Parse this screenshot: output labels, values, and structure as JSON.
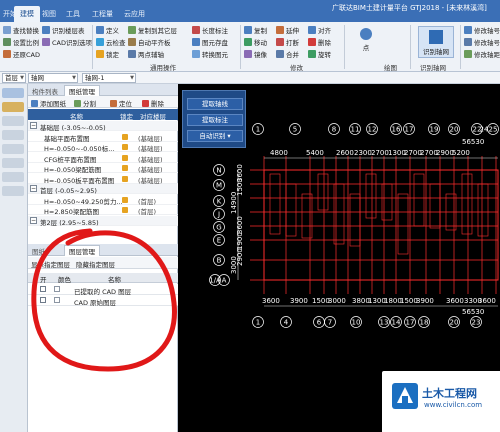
{
  "app": {
    "title": "广联达BIM土建计量平台 GTJ2018 - [未来林溪湾]"
  },
  "menu_tabs": [
    {
      "label": "开始",
      "active": false
    },
    {
      "label": "建模",
      "active": true
    },
    {
      "label": "视图",
      "active": false
    },
    {
      "label": "工具",
      "active": false
    },
    {
      "label": "工程量",
      "active": false
    },
    {
      "label": "云应用",
      "active": false
    }
  ],
  "ribbon": {
    "cad_group": {
      "items": [
        "查找替换",
        "设置比例",
        "还原CAD"
      ],
      "items2": [
        "识别楼层表",
        "CAD识别选项"
      ]
    },
    "general_group": {
      "label": "通用操作",
      "items": [
        "定义",
        "云检查",
        "锁定",
        "复制到其它层",
        "自动平齐板",
        "两点辅轴"
      ],
      "items2": [
        "长度标注",
        "图元存盘",
        "转换图元"
      ]
    },
    "edit_group": {
      "label": "修改",
      "items": [
        "复制",
        "移动",
        "镜像",
        "延伸",
        "打断",
        "合并",
        "对齐",
        "删除",
        "旋转"
      ]
    },
    "draw_group": {
      "label": "绘图",
      "items": [
        "点"
      ]
    },
    "identify_group": {
      "label": "识别轴网",
      "items": [
        "识别轴网"
      ]
    },
    "right_group": {
      "items": [
        "修改轴号位置",
        "修改轴号",
        "修改轴距"
      ]
    }
  },
  "propbar": {
    "floor_combo": "首层",
    "category_combo": "轴网",
    "element_combo": "轴网-1"
  },
  "panel": {
    "tabs": [
      {
        "label": "构件列表",
        "active": false
      },
      {
        "label": "图纸管理",
        "active": true
      }
    ],
    "toolbar": [
      "添加图纸",
      "分割",
      "定位",
      "删除"
    ],
    "columns": [
      "名称",
      "锁定",
      "对应楼层"
    ],
    "rows": [
      {
        "kind": "group",
        "name": "基础层 (-3.05~-0.05)"
      },
      {
        "kind": "item",
        "name": "基础平面布置图",
        "floor": "(基础层)"
      },
      {
        "kind": "item",
        "name": "H=-0.050~-0.050标...",
        "floor": "(基础层)"
      },
      {
        "kind": "item",
        "name": "CFG桩平面布置图",
        "floor": "(基础层)"
      },
      {
        "kind": "item",
        "name": "H=-0.050梁配筋图",
        "floor": "(基础层)"
      },
      {
        "kind": "item",
        "name": "H=-0.050板平面布置图",
        "floor": "(基础层)"
      },
      {
        "kind": "group",
        "name": "首层 (-0.05~2.95)"
      },
      {
        "kind": "item",
        "name": "H=-0.050~49.250剪力...",
        "floor": "(首层)"
      },
      {
        "kind": "item",
        "name": "H=2.850梁配筋图",
        "floor": "(首层)"
      },
      {
        "kind": "group",
        "name": "第2层 (2.95~5.85)"
      }
    ],
    "layer_tabs": [
      {
        "label": "图层管理",
        "active": true
      }
    ],
    "layer_toolbar": [
      "显示指定图层",
      "隐藏指定图层"
    ],
    "layer_columns": [
      "开",
      "颜色",
      "名称"
    ],
    "layers": [
      {
        "name": "已提取的 CAD 图层"
      },
      {
        "name": "CAD 原始图层"
      }
    ]
  },
  "floatmenu": [
    "提取轴线",
    "提取标注",
    "自动识别"
  ],
  "canvas": {
    "top_axes": [
      "1",
      "5",
      "8",
      "11",
      "12",
      "16",
      "17",
      "19",
      "20",
      "22",
      "25"
    ],
    "top_axes_extra": [
      "24"
    ],
    "top_dims": [
      "4800",
      "5400",
      "2600",
      "2300",
      "2700",
      "1300",
      "2700",
      "2700",
      "2900",
      "5200"
    ],
    "top_total": "56530",
    "bottom_axes": [
      "1",
      "4",
      "6",
      "7",
      "10",
      "13",
      "14",
      "17",
      "18",
      "20",
      "23"
    ],
    "bottom_dims": [
      "3600",
      "3900",
      "1500",
      "3000",
      "3800",
      "1300",
      "1800",
      "1500",
      "3900",
      "3600",
      "3300",
      "3600"
    ],
    "bottom_total": "56530",
    "left_axes": [
      "N",
      "M",
      "K",
      "J",
      "G",
      "E",
      "B",
      "1/A",
      "A"
    ],
    "left_dims": [
      "14900",
      "3600",
      "1500",
      "3600",
      "1900",
      "2900",
      "3000"
    ],
    "line_color": "#ff2d2d"
  },
  "watermark": {
    "title": "土木工程网",
    "url": "www.civilcn.com"
  },
  "colors": {
    "accent": "#3b6fb6",
    "panel_header": "#2f5f9e",
    "annotation": "#e01818"
  }
}
